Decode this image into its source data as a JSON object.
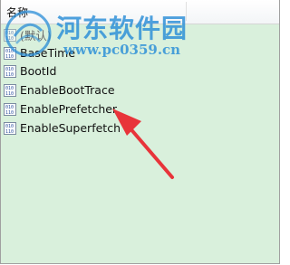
{
  "header": {
    "name_column": "名称"
  },
  "values": [
    {
      "name": "(默认)",
      "icon": "registry-binary-icon"
    },
    {
      "name": "BaseTime",
      "icon": "registry-binary-icon"
    },
    {
      "name": "BootId",
      "icon": "registry-binary-icon"
    },
    {
      "name": "EnableBootTrace",
      "icon": "registry-binary-icon"
    },
    {
      "name": "EnablePrefetcher",
      "icon": "registry-binary-icon"
    },
    {
      "name": "EnableSuperfetch",
      "icon": "registry-binary-icon"
    }
  ],
  "watermark": {
    "title": "河东软件园",
    "url": "www.pc0359.cn"
  },
  "colors": {
    "list_background": "#d9f0dc",
    "watermark": "#288cd7",
    "arrow": "#e8343a"
  }
}
